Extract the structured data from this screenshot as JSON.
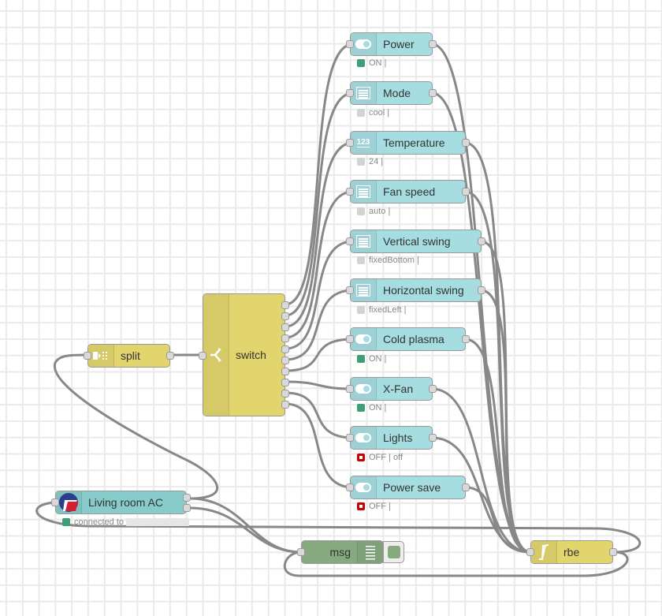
{
  "nodes": {
    "power": {
      "label": "Power",
      "status": "ON |",
      "status_color": "green"
    },
    "mode": {
      "label": "Mode",
      "status": "cool |",
      "status_color": "grey"
    },
    "temperature": {
      "label": "Temperature",
      "status": "24 |",
      "status_color": "grey",
      "icon_text": "123"
    },
    "fan_speed": {
      "label": "Fan speed",
      "status": "auto |",
      "status_color": "grey"
    },
    "vertical_swing": {
      "label": "Vertical swing",
      "status": "fixedBottom |",
      "status_color": "grey"
    },
    "horizontal_swing": {
      "label": "Horizontal swing",
      "status": "fixedLeft |",
      "status_color": "grey"
    },
    "cold_plasma": {
      "label": "Cold plasma",
      "status": "ON |",
      "status_color": "green"
    },
    "x_fan": {
      "label": "X-Fan",
      "status": "ON |",
      "status_color": "green"
    },
    "lights": {
      "label": "Lights",
      "status": "OFF | off",
      "status_color": "red-ring"
    },
    "power_save": {
      "label": "Power save",
      "status": "OFF |",
      "status_color": "red-ring"
    },
    "split": {
      "label": "split"
    },
    "switch": {
      "label": "switch",
      "outputs": 10
    },
    "living_room_ac": {
      "label": "Living room AC",
      "status": "connected to"
    },
    "msg": {
      "label": "msg"
    },
    "rbe": {
      "label": "rbe"
    }
  },
  "colors": {
    "ui_node": "#a6dde1",
    "device_node": "#87cbca",
    "function_node": "#e2d56e",
    "debug_node": "#87a980",
    "status_on": "#3e9e78",
    "status_off": "#cc0000",
    "wire": "#888888"
  }
}
